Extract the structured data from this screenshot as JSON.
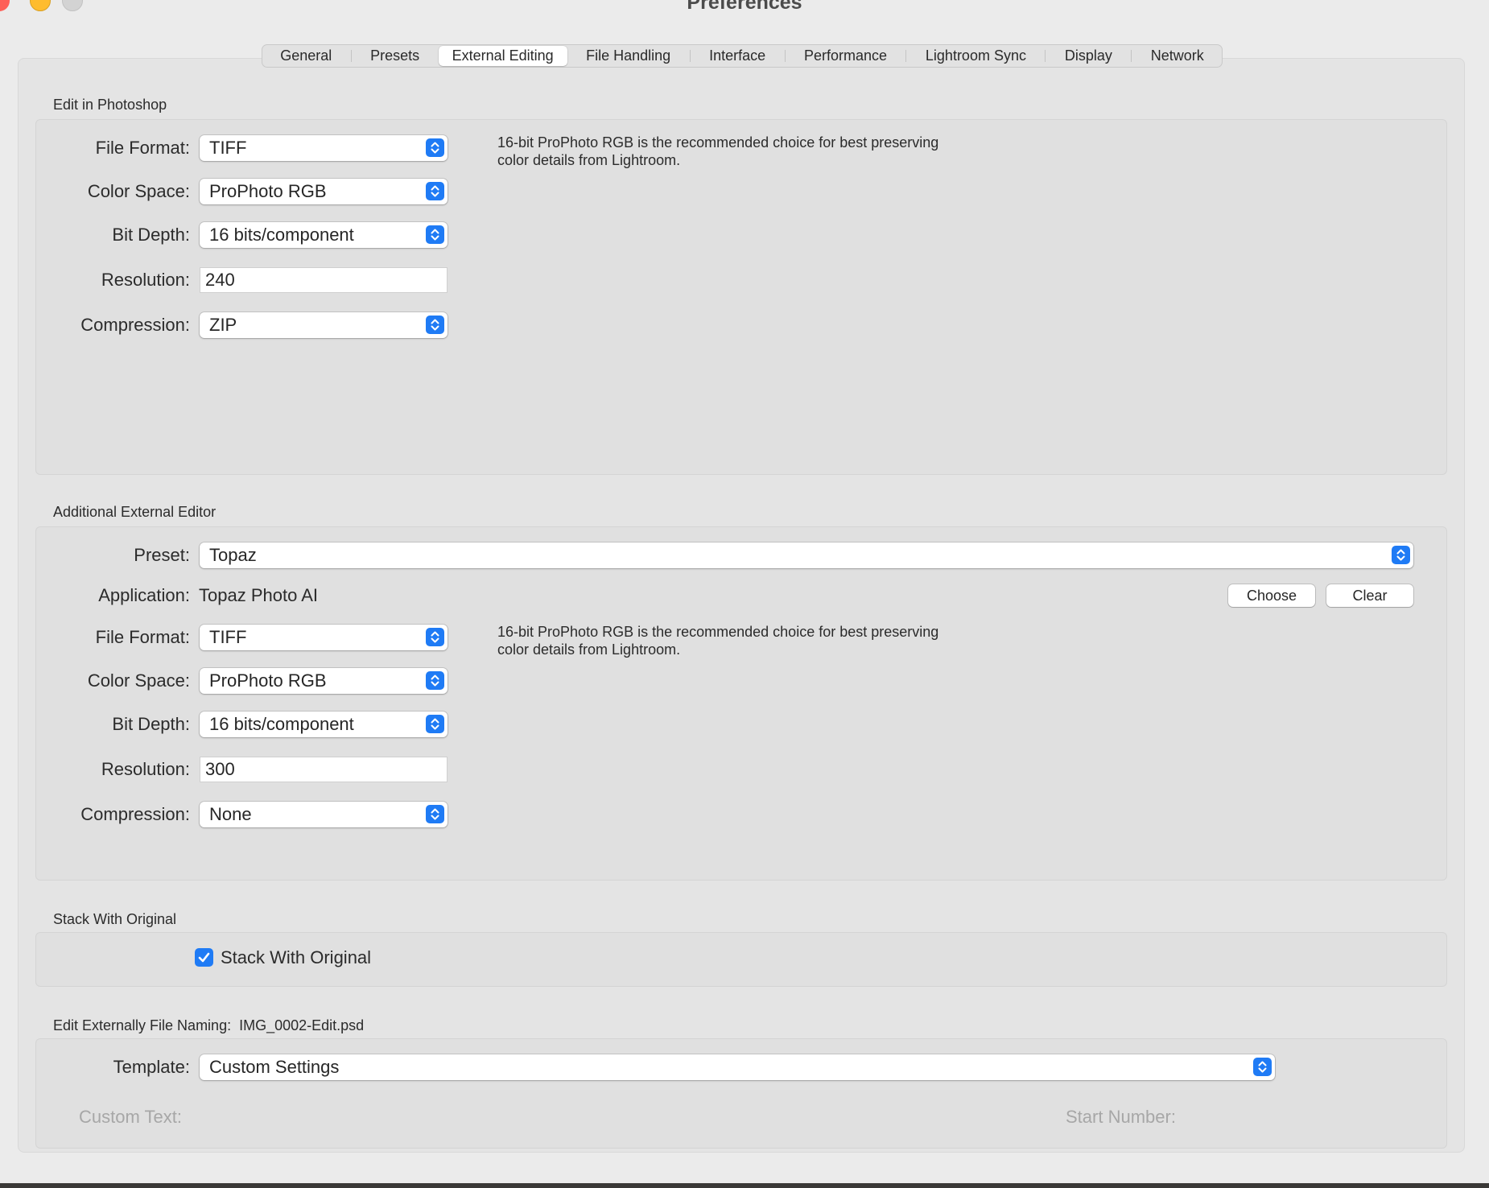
{
  "window": {
    "title": "Preferences"
  },
  "tabs": [
    {
      "label": "General"
    },
    {
      "label": "Presets"
    },
    {
      "label": "External Editing"
    },
    {
      "label": "File Handling"
    },
    {
      "label": "Interface"
    },
    {
      "label": "Performance"
    },
    {
      "label": "Lightroom Sync"
    },
    {
      "label": "Display"
    },
    {
      "label": "Network"
    }
  ],
  "active_tab": "External Editing",
  "photoshop": {
    "section_title": "Edit in Photoshop",
    "file_format": {
      "label": "File Format:",
      "value": "TIFF"
    },
    "color_space": {
      "label": "Color Space:",
      "value": "ProPhoto RGB"
    },
    "bit_depth": {
      "label": "Bit Depth:",
      "value": "16 bits/component"
    },
    "resolution": {
      "label": "Resolution:",
      "value": "240"
    },
    "compression": {
      "label": "Compression:",
      "value": "ZIP"
    },
    "note_line1": "16-bit ProPhoto RGB is the recommended choice for best preserving",
    "note_line2": "color details from Lightroom."
  },
  "additional": {
    "section_title": "Additional External Editor",
    "preset": {
      "label": "Preset:",
      "value": "Topaz"
    },
    "application": {
      "label": "Application:",
      "value": "Topaz Photo AI"
    },
    "choose_label": "Choose",
    "clear_label": "Clear",
    "file_format": {
      "label": "File Format:",
      "value": "TIFF"
    },
    "color_space": {
      "label": "Color Space:",
      "value": "ProPhoto RGB"
    },
    "bit_depth": {
      "label": "Bit Depth:",
      "value": "16 bits/component"
    },
    "resolution": {
      "label": "Resolution:",
      "value": "300"
    },
    "compression": {
      "label": "Compression:",
      "value": "None"
    },
    "note_line1": "16-bit ProPhoto RGB is the recommended choice for best preserving",
    "note_line2": "color details from Lightroom."
  },
  "stack": {
    "section_title": "Stack With Original",
    "checkbox_label": "Stack With Original",
    "checked": true
  },
  "naming": {
    "section_title": "Edit Externally File Naming:",
    "example": "IMG_0002-Edit.psd",
    "template": {
      "label": "Template:",
      "value": "Custom Settings"
    },
    "custom_text_label": "Custom Text:",
    "start_number_label": "Start Number:"
  },
  "colors": {
    "accent": "#1f7bf5",
    "close": "#fe5f57",
    "minimize": "#febc2e"
  }
}
